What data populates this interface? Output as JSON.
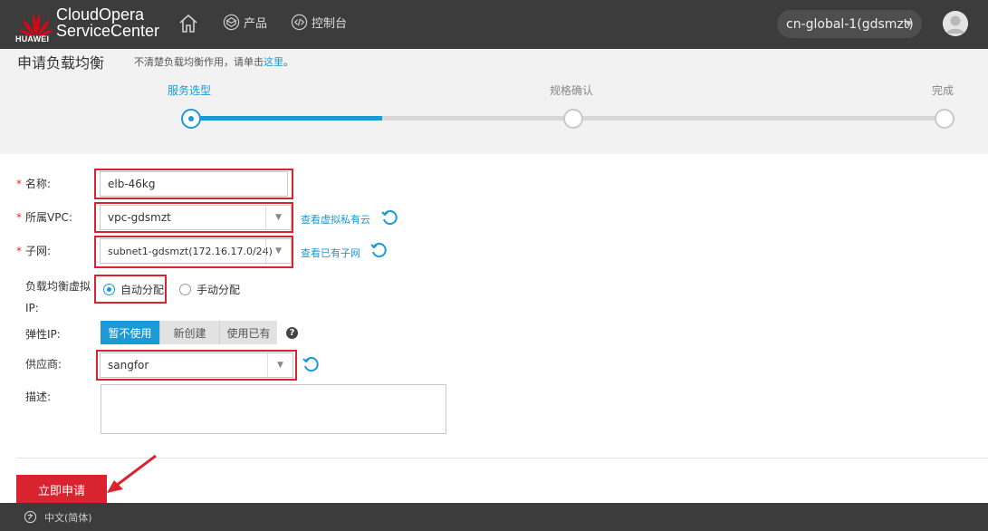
{
  "header": {
    "logo_text": "HUAWEI",
    "brand_line1": "CloudOpera",
    "brand_line2": "ServiceCenter",
    "nav": [
      {
        "label": "产品",
        "icon": "product-icon"
      },
      {
        "label": "控制台",
        "icon": "console-icon"
      }
    ],
    "region": "cn-global-1(gdsmzt)"
  },
  "page": {
    "title": "申请负载均衡",
    "help_prefix": "不清楚负载均衡作用，请单击",
    "help_link": "这里",
    "help_suffix": "。"
  },
  "steps": [
    {
      "label": "服务选型",
      "active": true
    },
    {
      "label": "规格确认",
      "active": false
    },
    {
      "label": "完成",
      "active": false
    }
  ],
  "form": {
    "name": {
      "label": "名称:",
      "value": "elb-46kg"
    },
    "vpc": {
      "label": "所属VPC:",
      "value": "vpc-gdsmzt",
      "link": "查看虚拟私有云"
    },
    "subnet": {
      "label": "子网:",
      "value": "subnet1-gdsmzt(172.16.17.0/24)",
      "link": "查看已有子网"
    },
    "vip": {
      "label_line1": "负载均衡虚拟",
      "label_line2": "IP:",
      "options": [
        "自动分配",
        "手动分配"
      ],
      "selected": "自动分配"
    },
    "eip": {
      "label": "弹性IP:",
      "options": [
        "暂不使用",
        "新创建",
        "使用已有"
      ],
      "selected": "暂不使用"
    },
    "vendor": {
      "label": "供应商:",
      "value": "sangfor"
    },
    "desc": {
      "label": "描述:",
      "value": ""
    }
  },
  "submit_label": "立即申请",
  "footer": {
    "language": "中文(简体)"
  },
  "colors": {
    "accent": "#1a9ad6",
    "highlight": "#d9232e",
    "header_bg": "#3c3c3c"
  }
}
